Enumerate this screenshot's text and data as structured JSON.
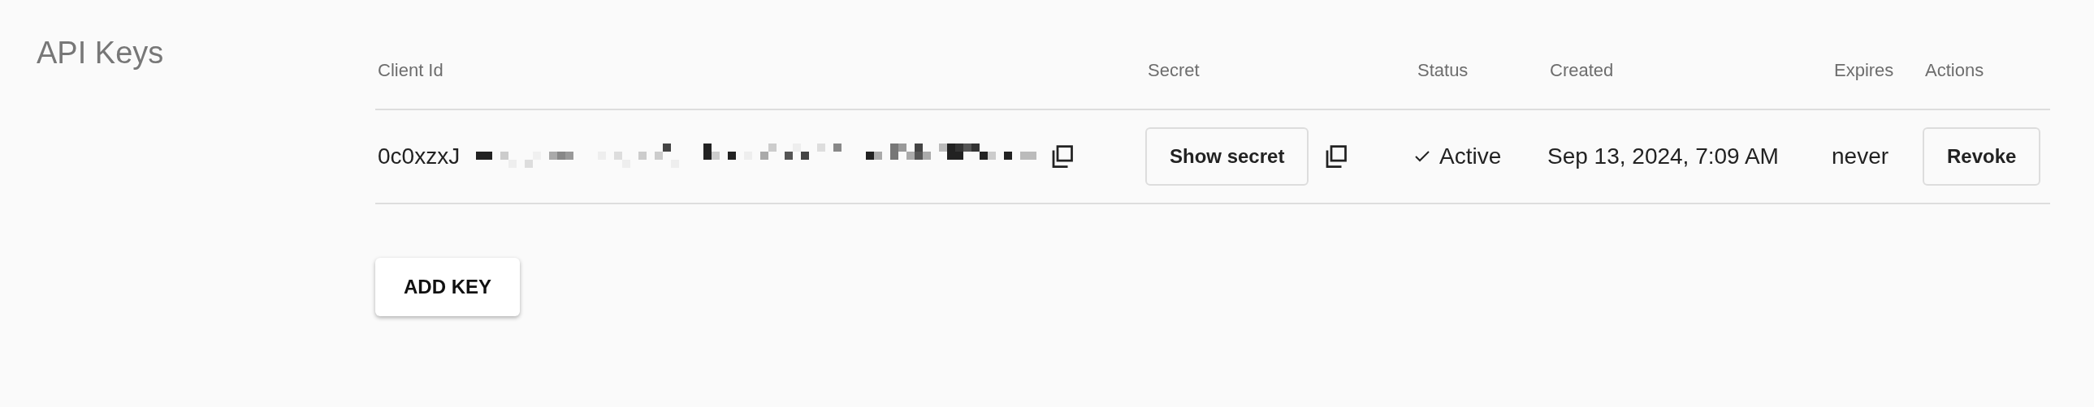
{
  "title": "API Keys",
  "table": {
    "columns": [
      "Client Id",
      "Secret",
      "Status",
      "Created",
      "Expires",
      "Actions"
    ],
    "rows": [
      {
        "client_id": "0c0xzxJ",
        "secret_button": "Show secret",
        "status": "Active",
        "created": "Sep 13, 2024, 7:09 AM",
        "expires": "never",
        "action": "Revoke"
      }
    ]
  },
  "add_button": "ADD KEY"
}
